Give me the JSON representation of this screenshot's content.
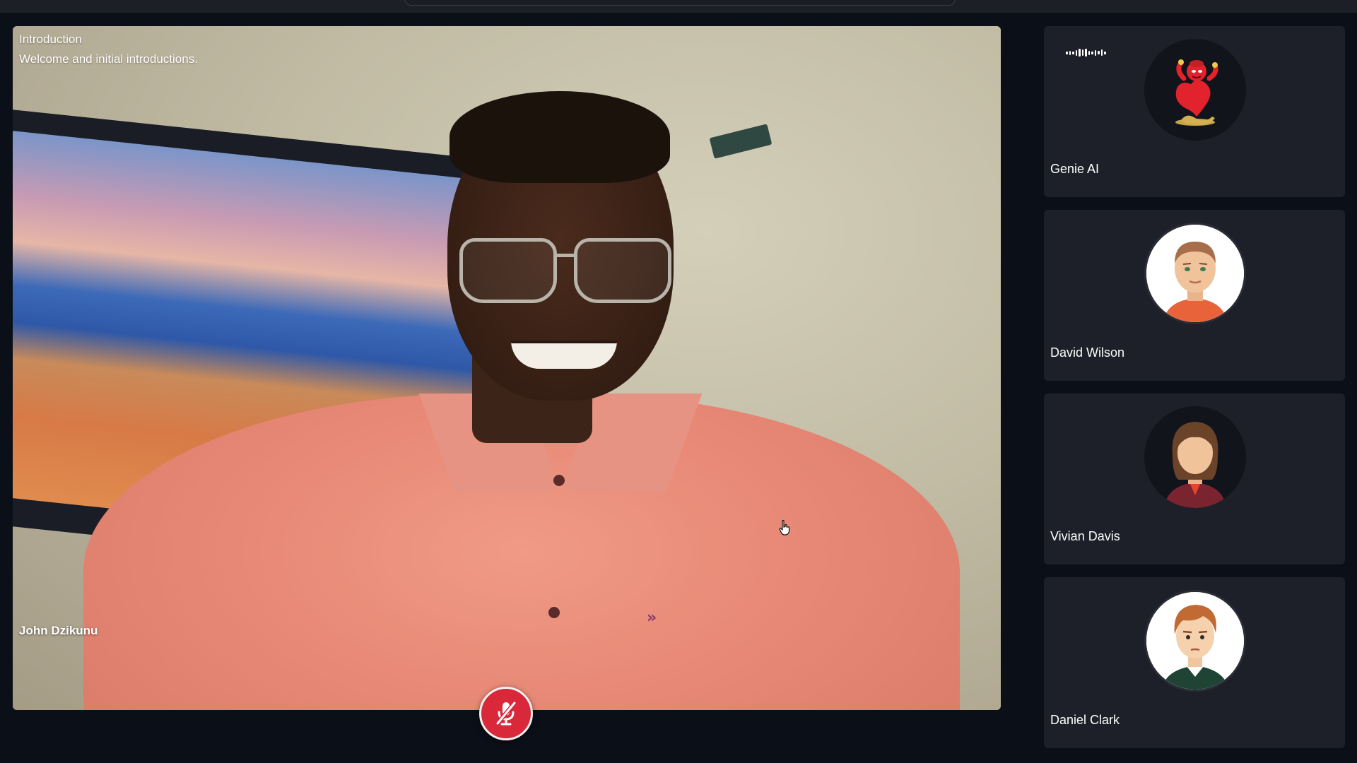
{
  "agenda": {
    "title": "Introduction",
    "subtitle": "Welcome and initial introductions."
  },
  "main_video": {
    "speaker_name": "John Dzikunu"
  },
  "controls": {
    "mic_state": "muted",
    "mic_icon": "mic-off-icon",
    "mic_color": "#d8283a"
  },
  "participants": [
    {
      "name": "Genie AI",
      "avatar": "genie-avatar",
      "speaking": true
    },
    {
      "name": "David Wilson",
      "avatar": "man-avatar"
    },
    {
      "name": "Vivian Davis",
      "avatar": "woman-avatar"
    },
    {
      "name": "Daniel Clark",
      "avatar": "man-avatar"
    }
  ],
  "colors": {
    "background": "#0b0f17",
    "tile": "#1d2028",
    "accent_red": "#d8283a"
  }
}
